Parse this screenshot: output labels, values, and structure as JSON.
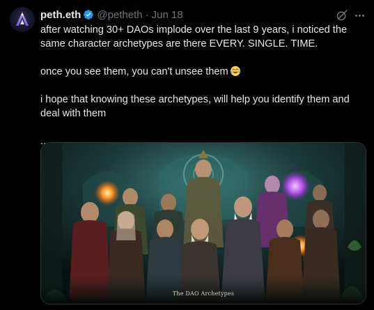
{
  "tweet": {
    "author_name": "peth.eth",
    "handle": "@petheth",
    "separator": "·",
    "date": "Jun 18",
    "text": {
      "line1": "after watching 30+ DAOs implode over the last 9 years, i noticed the same character archetypes are there EVERY. SINGLE. TIME.",
      "line2": "once you see them, you can't unsee them",
      "line3": "i hope that knowing these archetypes, will help you identify them and deal with them",
      "line4": "..."
    },
    "emoji": "face-with-tears-of-joy",
    "media": {
      "caption": "The DAO Archetypes"
    }
  },
  "icons": {
    "verified": "verified-badge-icon",
    "grok": "grok-icon",
    "more": "more-options-icon"
  },
  "colors": {
    "background": "#000000",
    "text_primary": "#e7e9ea",
    "text_secondary": "#71767b",
    "verified_blue": "#1d9bf0",
    "media_border": "#2f3336"
  }
}
